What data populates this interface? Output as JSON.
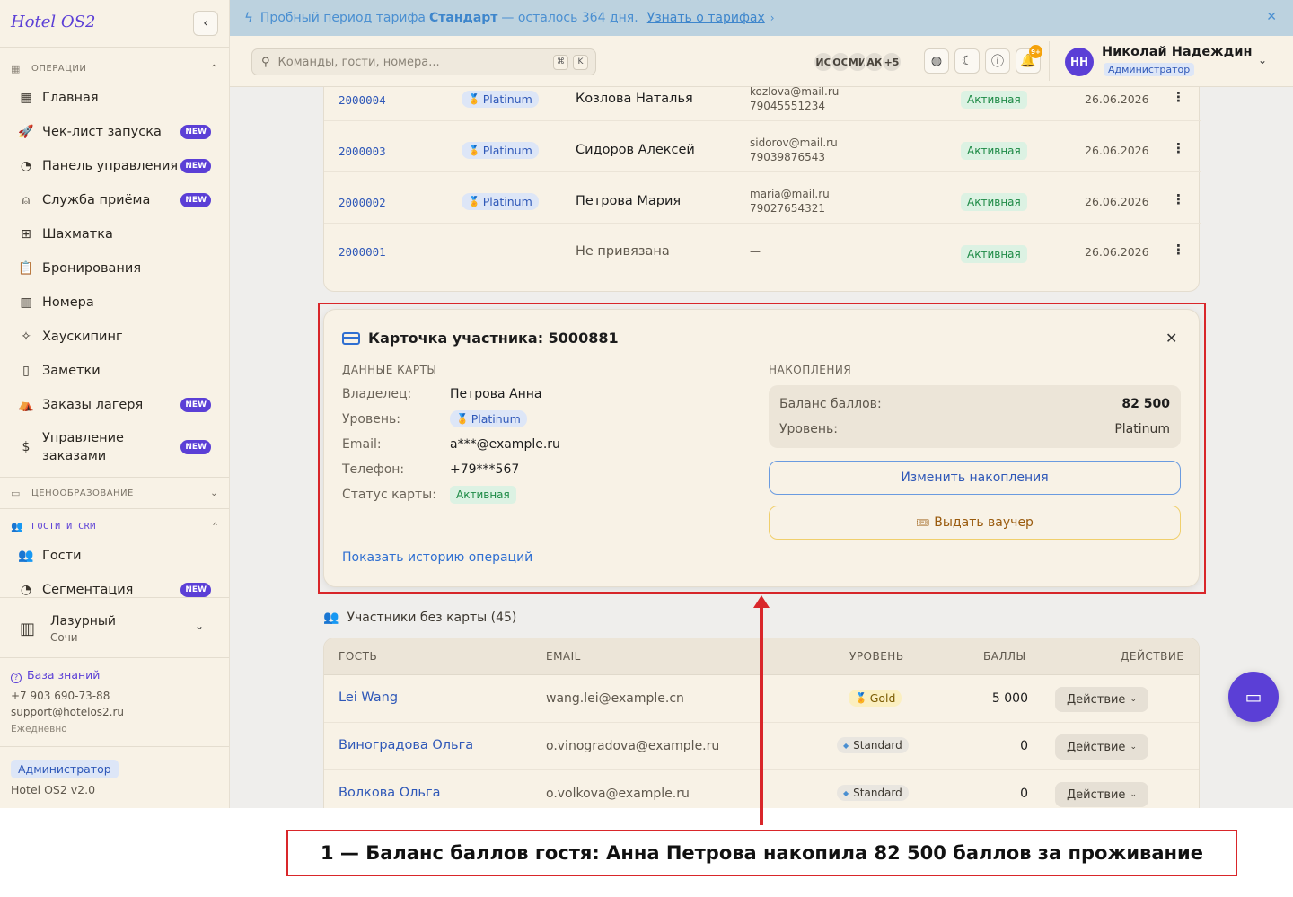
{
  "banner": {
    "prefix": "Пробный период тарифа",
    "plan": "Стандарт",
    "suffix": "— осталось 364 дня.",
    "link": "Узнать о тарифах"
  },
  "sidebar": {
    "brand": "Hotel OS2",
    "sections": {
      "ops": "ОПЕРАЦИИ",
      "pricing": "ЦЕНООБРАЗОВАНИЕ",
      "crm": "ГОСТИ И CRM"
    },
    "items": [
      {
        "label": "Главная",
        "icon": "dashboard-icon"
      },
      {
        "label": "Чек-лист запуска",
        "icon": "rocket-icon",
        "badge": "NEW"
      },
      {
        "label": "Панель управления",
        "icon": "gauge-icon",
        "badge": "NEW"
      },
      {
        "label": "Служба приёма",
        "icon": "concierge-bell-icon",
        "badge": "NEW"
      },
      {
        "label": "Шахматка",
        "icon": "grid-icon"
      },
      {
        "label": "Бронирования",
        "icon": "clipboard-icon"
      },
      {
        "label": "Номера",
        "icon": "building-icon"
      },
      {
        "label": "Хаускипинг",
        "icon": "sparkles-icon"
      },
      {
        "label": "Заметки",
        "icon": "note-icon"
      },
      {
        "label": "Заказы лагеря",
        "icon": "tent-icon",
        "badge": "NEW"
      },
      {
        "label": "Управление заказами",
        "icon": "receipt-icon",
        "badge": "NEW"
      },
      {
        "label": "Гости",
        "icon": "users-icon"
      },
      {
        "label": "Сегментация",
        "icon": "pie-chart-icon",
        "badge": "NEW"
      }
    ],
    "hotel": {
      "name": "Лазурный",
      "city": "Сочи"
    },
    "knowledge_base": "База знаний",
    "phone": "+7 903 690-73-88",
    "email": "support@hotelos2.ru",
    "hours": "Ежедневно",
    "role": "Администратор",
    "version": "Hotel OS2 v2.0"
  },
  "topbar": {
    "search_placeholder": "Команды, гости, номера...",
    "kbd_1": "⌘",
    "kbd_2": "K",
    "avatars": [
      "ИС",
      "ОС",
      "МИ",
      "АК",
      "+5"
    ],
    "bell_badge": "9+",
    "user_initials": "НН",
    "user_name": "Николай Надеждин",
    "user_role": "Администратор"
  },
  "cards_table": {
    "rows": [
      {
        "number": "2000004",
        "tier": "Platinum",
        "owner": "Козлова Наталья",
        "email": "kozlova@mail.ru",
        "phone": "79045551234",
        "status": "Активная",
        "date": "26.06.2026"
      },
      {
        "number": "2000003",
        "tier": "Platinum",
        "owner": "Сидоров Алексей",
        "email": "sidorov@mail.ru",
        "phone": "79039876543",
        "status": "Активная",
        "date": "26.06.2026"
      },
      {
        "number": "2000002",
        "tier": "Platinum",
        "owner": "Петрова Мария",
        "email": "maria@mail.ru",
        "phone": "79027654321",
        "status": "Активная",
        "date": "26.06.2026"
      },
      {
        "number": "2000001",
        "tier": "—",
        "owner": "Не привязана",
        "email": "—",
        "phone": "",
        "status": "Активная",
        "date": "26.06.2026"
      }
    ]
  },
  "member_card": {
    "title": "Карточка участника: 5000881",
    "card_data_label": "ДАННЫЕ КАРТЫ",
    "fields": [
      {
        "key": "Владелец:",
        "value": "Петрова Анна"
      },
      {
        "key": "Уровень:",
        "value": "Platinum"
      },
      {
        "key": "Email:",
        "value": "a***@example.ru"
      },
      {
        "key": "Телефон:",
        "value": "+79***567"
      },
      {
        "key": "Статус карты:",
        "value": "Активная"
      }
    ],
    "history_link": "Показать историю операций",
    "accum_label": "НАКОПЛЕНИЯ",
    "balance_key": "Баланс баллов:",
    "balance_value": "82 500",
    "level_key": "Уровень:",
    "level_value": "Platinum",
    "edit_button": "Изменить накопления",
    "voucher_button": "Выдать ваучер"
  },
  "no_card": {
    "title": "Участники без карты (45)",
    "headers": {
      "guest": "ГОСТЬ",
      "email": "EMAIL",
      "level": "УРОВЕНЬ",
      "points": "БАЛЛЫ",
      "action": "ДЕЙСТВИЕ"
    },
    "rows": [
      {
        "guest": "Lei Wang",
        "email": "wang.lei@example.cn",
        "level": "Gold",
        "points": "5 000",
        "action": "Действие"
      },
      {
        "guest": "Виноградова Ольга",
        "email": "o.vinogradova@example.ru",
        "level": "Standard",
        "points": "0",
        "action": "Действие"
      },
      {
        "guest": "Волкова Ольга",
        "email": "o.volkova@example.ru",
        "level": "Standard",
        "points": "0",
        "action": "Действие"
      }
    ]
  },
  "annotation": {
    "caption": "1 — Баланс баллов гостя: Анна Петрова накопила 82 500 баллов за проживание"
  },
  "colors": {
    "accent": "#5b3fd6",
    "highlight": "#d9262a",
    "link": "#2f58b8"
  }
}
